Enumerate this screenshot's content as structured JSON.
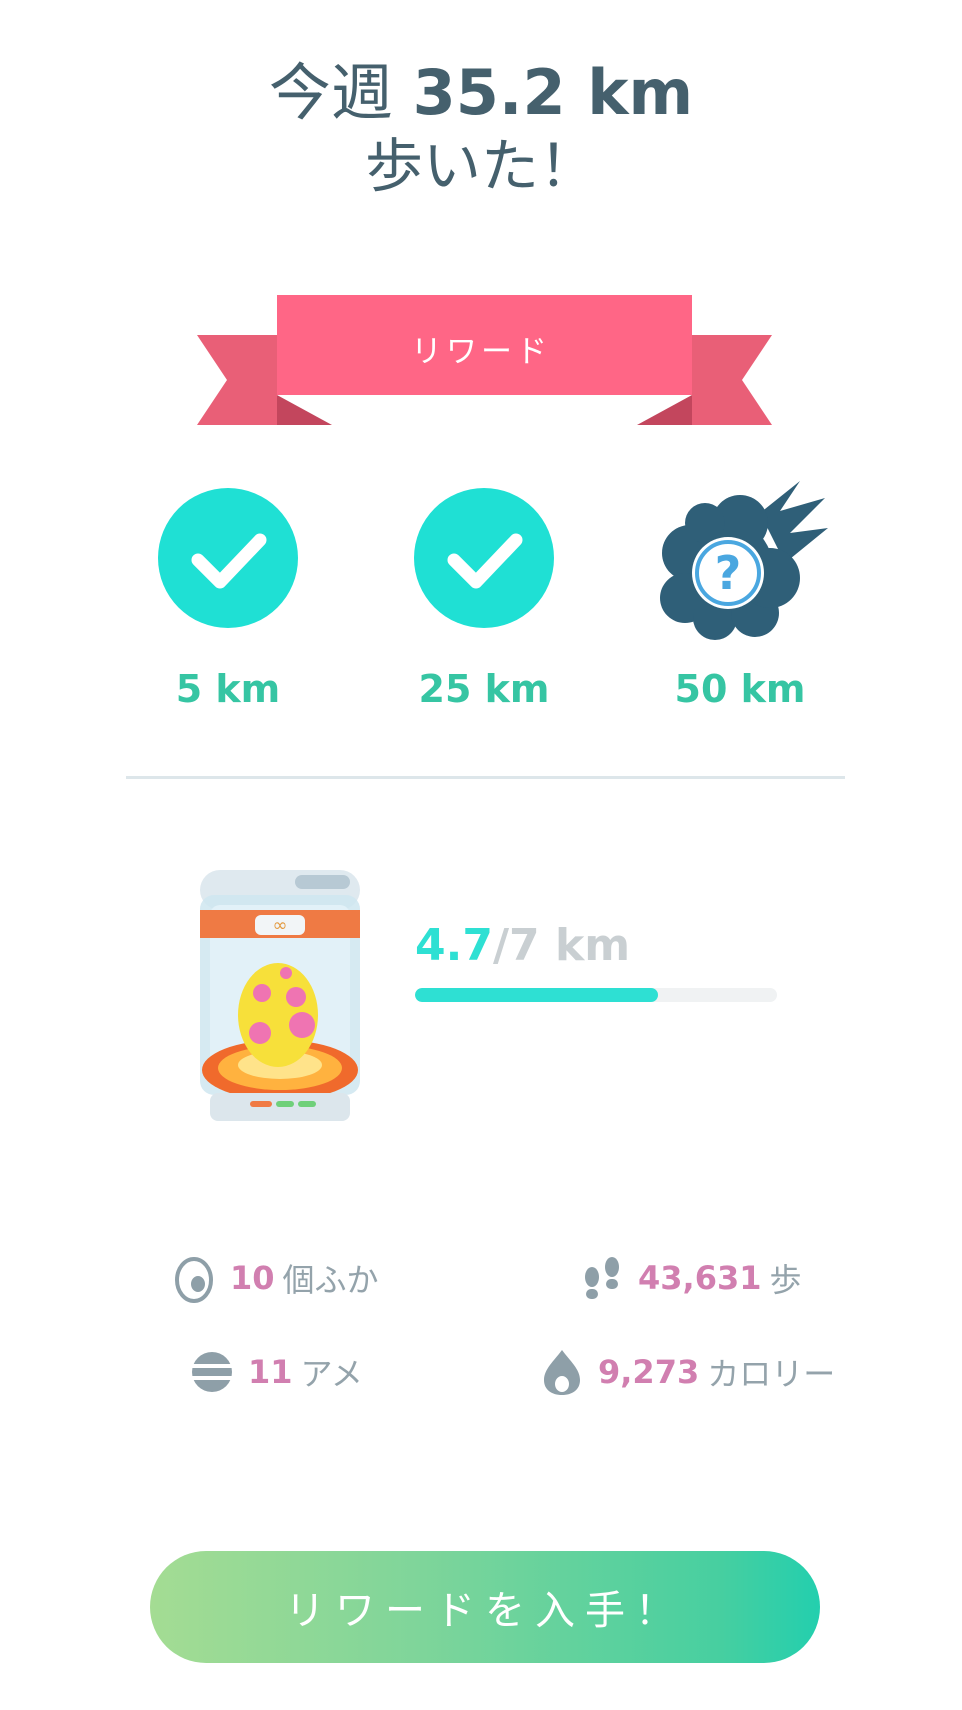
{
  "header": {
    "prefix": "今週",
    "distance": "35.2 km",
    "line2": "歩いた！"
  },
  "ribbon": {
    "label": "リワード",
    "color": "#ff6686"
  },
  "milestones": [
    {
      "label": "5 km",
      "status": "completed",
      "icon": "check-icon"
    },
    {
      "label": "25 km",
      "status": "completed",
      "icon": "check-icon"
    },
    {
      "label": "50 km",
      "status": "mystery",
      "icon": "mystery-reward-icon"
    }
  ],
  "incubator": {
    "current": "4.7",
    "total": "/7 km",
    "progress_fraction": 0.671,
    "icon": "incubator-egg-icon"
  },
  "stats": {
    "hatched": {
      "value": "10",
      "unit": "個ふか",
      "icon": "egg-outline-icon"
    },
    "steps": {
      "value": "43,631",
      "unit": "歩",
      "icon": "footprints-icon"
    },
    "candy": {
      "value": "11",
      "unit": "アメ",
      "icon": "candy-icon"
    },
    "calories": {
      "value": "9,273",
      "unit": "カロリー",
      "icon": "flame-icon"
    }
  },
  "cta": {
    "label": "リワードを入手！"
  },
  "colors": {
    "accent_teal": "#2ee0d3",
    "milestone_green": "#36c5a3",
    "stat_pink": "#d17fb0",
    "title_slate": "#45606d"
  }
}
